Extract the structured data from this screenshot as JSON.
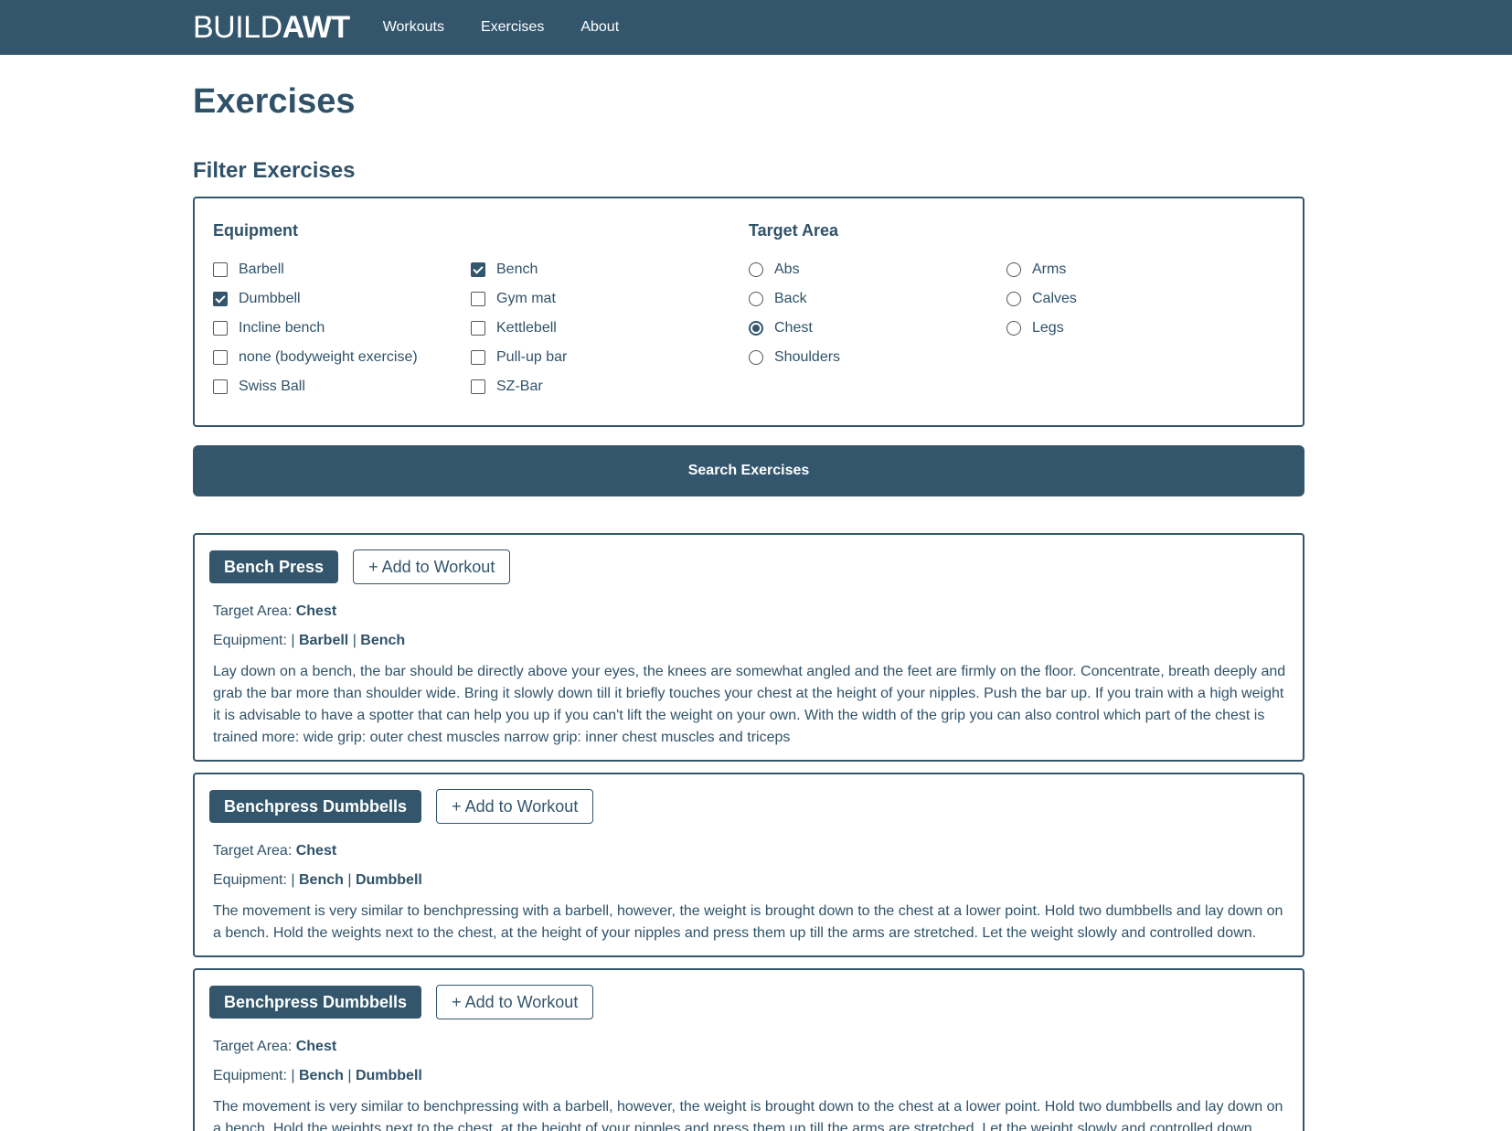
{
  "nav": {
    "brand_thin": "BUILD",
    "brand_bold": "AWT",
    "links": [
      "Workouts",
      "Exercises",
      "About"
    ]
  },
  "page_title": "Exercises",
  "filter": {
    "title": "Filter Exercises",
    "equipment_title": "Equipment",
    "equipment": [
      {
        "label": "Barbell",
        "checked": false
      },
      {
        "label": "Bench",
        "checked": true
      },
      {
        "label": "Dumbbell",
        "checked": true
      },
      {
        "label": "Gym mat",
        "checked": false
      },
      {
        "label": "Incline bench",
        "checked": false
      },
      {
        "label": "Kettlebell",
        "checked": false
      },
      {
        "label": "none (bodyweight exercise)",
        "checked": false
      },
      {
        "label": "Pull-up bar",
        "checked": false
      },
      {
        "label": "Swiss Ball",
        "checked": false
      },
      {
        "label": "SZ-Bar",
        "checked": false
      }
    ],
    "target_title": "Target Area",
    "targets": [
      {
        "label": "Abs",
        "checked": false
      },
      {
        "label": "Arms",
        "checked": false
      },
      {
        "label": "Back",
        "checked": false
      },
      {
        "label": "Calves",
        "checked": false
      },
      {
        "label": "Chest",
        "checked": true
      },
      {
        "label": "Legs",
        "checked": false
      },
      {
        "label": "Shoulders",
        "checked": false
      }
    ],
    "search_label": "Search Exercises"
  },
  "results": [
    {
      "name": "Bench Press",
      "add_label": "+ Add to Workout",
      "target_label": "Target Area: ",
      "target": "Chest",
      "equipment_label": "Equipment: ",
      "equipment": [
        "Barbell",
        "Bench"
      ],
      "description": "Lay down on a bench, the bar should be directly above your eyes, the knees are somewhat angled and the feet are firmly on the floor. Concentrate, breath deeply and grab the bar more than shoulder wide. Bring it slowly down till it briefly touches your chest at the height of your nipples. Push the bar up. If you train with a high weight it is advisable to have a spotter that can help you up if you can't lift the weight on your own. With the width of the grip you can also control which part of the chest is trained more: wide grip: outer chest muscles narrow grip: inner chest muscles and triceps"
    },
    {
      "name": "Benchpress Dumbbells",
      "add_label": "+ Add to Workout",
      "target_label": "Target Area: ",
      "target": "Chest",
      "equipment_label": "Equipment: ",
      "equipment": [
        "Bench",
        "Dumbbell"
      ],
      "description": "The movement is very similar to benchpressing with a barbell, however, the weight is brought down to the chest at a lower point. Hold two dumbbells and lay down on a bench. Hold the weights next to the chest, at the height of your nipples and press them up till the arms are stretched. Let the weight slowly and controlled down."
    },
    {
      "name": "Benchpress Dumbbells",
      "add_label": "+ Add to Workout",
      "target_label": "Target Area: ",
      "target": "Chest",
      "equipment_label": "Equipment: ",
      "equipment": [
        "Bench",
        "Dumbbell"
      ],
      "description": "The movement is very similar to benchpressing with a barbell, however, the weight is brought down to the chest at a lower point. Hold two dumbbells and lay down on a bench. Hold the weights next to the chest, at the height of your nipples and press them up till the arms are stretched. Let the weight slowly and controlled down."
    }
  ]
}
